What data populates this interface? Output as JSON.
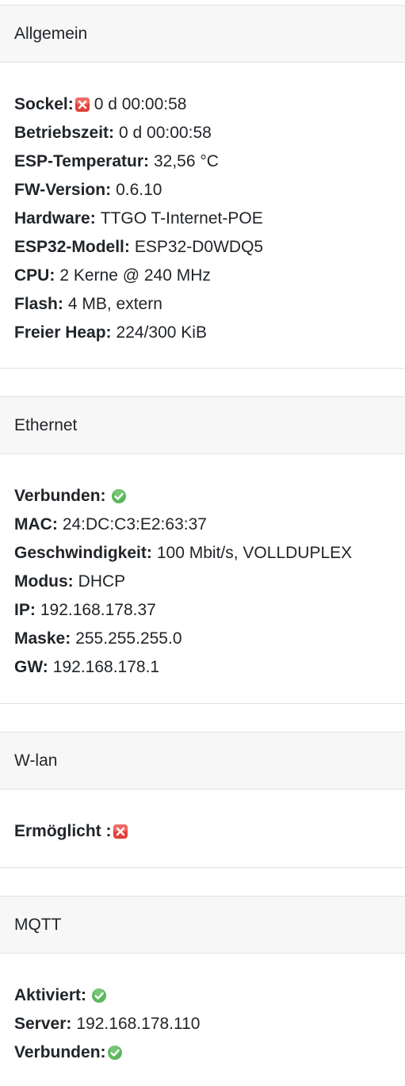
{
  "sections": {
    "allgemein": {
      "title": "Allgemein",
      "sockel": {
        "label": "Sockel:",
        "status_icon": "error-icon",
        "value": "0 d 00:00:58"
      },
      "betriebszeit": {
        "label": "Betriebszeit:",
        "value": "0 d 00:00:58"
      },
      "esp_temperatur": {
        "label": "ESP-Temperatur:",
        "value": "32,56 °C"
      },
      "fw_version": {
        "label": "FW-Version:",
        "value": "0.6.10"
      },
      "hardware": {
        "label": "Hardware:",
        "value": "TTGO T-Internet-POE"
      },
      "esp32_modell": {
        "label": "ESP32-Modell:",
        "value": "ESP32-D0WDQ5"
      },
      "cpu": {
        "label": "CPU:",
        "value": "2 Kerne @ 240 MHz"
      },
      "flash": {
        "label": "Flash:",
        "value": "4 MB, extern"
      },
      "freier_heap": {
        "label": "Freier Heap:",
        "value": "224/300 KiB"
      }
    },
    "ethernet": {
      "title": "Ethernet",
      "verbunden": {
        "label": "Verbunden:",
        "status_icon": "check-icon"
      },
      "mac": {
        "label": "MAC:",
        "value": "24:DC:C3:E2:63:37"
      },
      "geschwindigkeit": {
        "label": "Geschwindigkeit:",
        "value": "100 Mbit/s, VOLLDUPLEX"
      },
      "modus": {
        "label": "Modus:",
        "value": "DHCP"
      },
      "ip": {
        "label": "IP:",
        "value": "192.168.178.37"
      },
      "maske": {
        "label": "Maske:",
        "value": "255.255.255.0"
      },
      "gw": {
        "label": "GW:",
        "value": "192.168.178.1"
      }
    },
    "wlan": {
      "title": "W-lan",
      "ermoeglicht": {
        "label": "Ermöglicht :",
        "status_icon": "error-icon"
      }
    },
    "mqtt": {
      "title": "MQTT",
      "aktiviert": {
        "label": "Aktiviert:",
        "status_icon": "check-icon"
      },
      "server": {
        "label": "Server:",
        "value": "192.168.178.110"
      },
      "verbunden": {
        "label": "Verbunden:",
        "status_icon": "check-icon"
      }
    }
  },
  "colors": {
    "header_bg": "#f7f7f7",
    "border": "#dee2e6",
    "text": "#212529",
    "error_red": "#e0413a",
    "ok_green": "#5cb85c"
  }
}
